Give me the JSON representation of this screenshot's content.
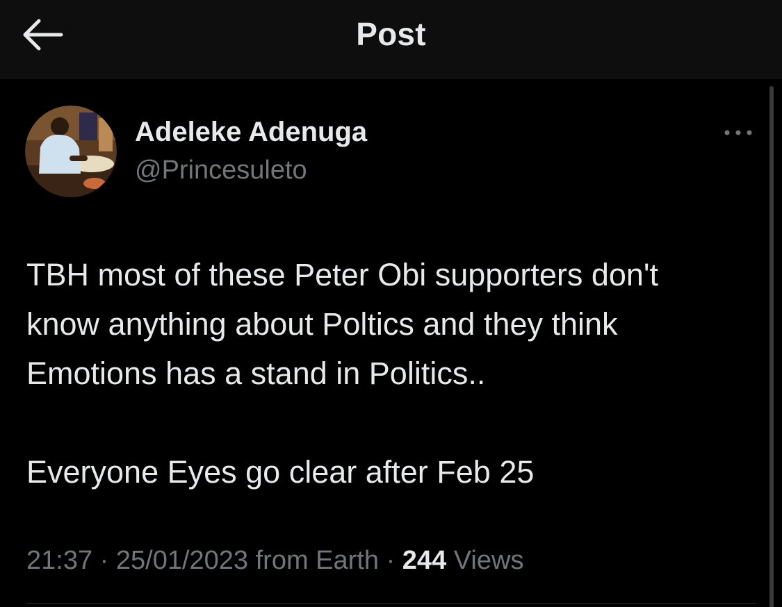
{
  "header": {
    "title": "Post",
    "back_icon": "arrow-left-icon"
  },
  "post": {
    "author": {
      "display_name": "Adeleke Adenuga",
      "handle": "@Princesuleto"
    },
    "more_icon": "more-horizontal-icon",
    "text_lines": [
      "TBH most of these Peter Obi supporters don't",
      "know anything about Poltics and they think",
      "Emotions has a stand in Politics.."
    ],
    "text_line_2": "Everyone Eyes go clear after Feb 25",
    "time": "21:37",
    "separator": "·",
    "date": "25/01/2023",
    "source": "from Earth",
    "views_count": "244",
    "views_label": "Views"
  },
  "colors": {
    "background": "#000000",
    "header_background": "#0e0e0e",
    "primary_text": "#e7e9ea",
    "secondary_text": "#71767b",
    "divider": "#2f3336"
  }
}
